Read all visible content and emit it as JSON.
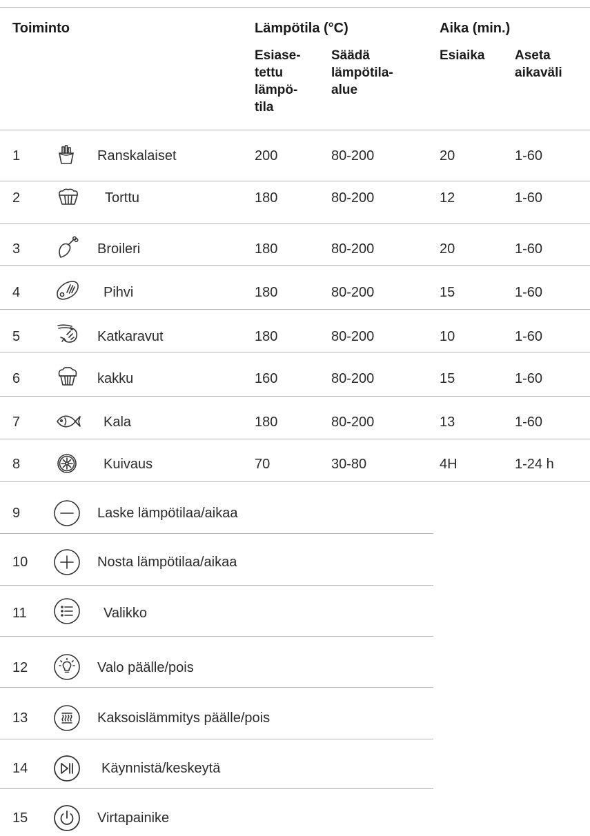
{
  "header": {
    "toiminto": "Toiminto",
    "lampotila": "Lämpötila (°C)",
    "aika": "Aika (min.)",
    "esiasetettu_lines": [
      "Esiase-",
      "tettu",
      "lämpö-",
      "tila"
    ],
    "saada_lines": [
      "Säädä",
      "lämpötila-",
      "alue"
    ],
    "esiaika": "Esiaika",
    "aseta_lines": [
      "Aseta",
      "aikaväli"
    ]
  },
  "functions": [
    {
      "num": "1",
      "icon": "fries-icon",
      "name": "Ranskalaiset",
      "preset_temp": "200",
      "temp_range": "80-200",
      "preset_time": "20",
      "time_range": "1-60"
    },
    {
      "num": "2",
      "icon": "tart-icon",
      "name": "Torttu",
      "preset_temp": "180",
      "temp_range": "80-200",
      "preset_time": "12",
      "time_range": "1-60"
    },
    {
      "num": "3",
      "icon": "drumstick-icon",
      "name": "Broileri",
      "preset_temp": "180",
      "temp_range": "80-200",
      "preset_time": "20",
      "time_range": "1-60"
    },
    {
      "num": "4",
      "icon": "steak-icon",
      "name": "Pihvi",
      "preset_temp": "180",
      "temp_range": "80-200",
      "preset_time": "15",
      "time_range": "1-60"
    },
    {
      "num": "5",
      "icon": "shrimp-icon",
      "name": "Katkaravut",
      "preset_temp": "180",
      "temp_range": "80-200",
      "preset_time": "10",
      "time_range": "1-60"
    },
    {
      "num": "6",
      "icon": "cake-icon",
      "name": "kakku",
      "preset_temp": "160",
      "temp_range": "80-200",
      "preset_time": "15",
      "time_range": "1-60"
    },
    {
      "num": "7",
      "icon": "fish-icon",
      "name": "Kala",
      "preset_temp": "180",
      "temp_range": "80-200",
      "preset_time": "13",
      "time_range": "1-60"
    },
    {
      "num": "8",
      "icon": "dehydrate-icon",
      "name": "Kuivaus",
      "preset_temp": "70",
      "temp_range": "30-80",
      "preset_time": "4H",
      "time_range": "1-24 h"
    }
  ],
  "buttons": [
    {
      "num": "9",
      "icon": "minus-circle-icon",
      "label": "Laske lämpötilaa/aikaa"
    },
    {
      "num": "10",
      "icon": "plus-circle-icon",
      "label": "Nosta lämpötilaa/aikaa"
    },
    {
      "num": "11",
      "icon": "menu-circle-icon",
      "label": "Valikko"
    },
    {
      "num": "12",
      "icon": "light-bulb-icon",
      "label": "Valo päälle/pois"
    },
    {
      "num": "13",
      "icon": "dual-heat-icon",
      "label": "Kaksoislämmitys päälle/pois"
    },
    {
      "num": "14",
      "icon": "play-pause-icon",
      "label": "Käynnistä/keskeytä"
    },
    {
      "num": "15",
      "icon": "power-icon",
      "label": "Virtapainike"
    }
  ]
}
